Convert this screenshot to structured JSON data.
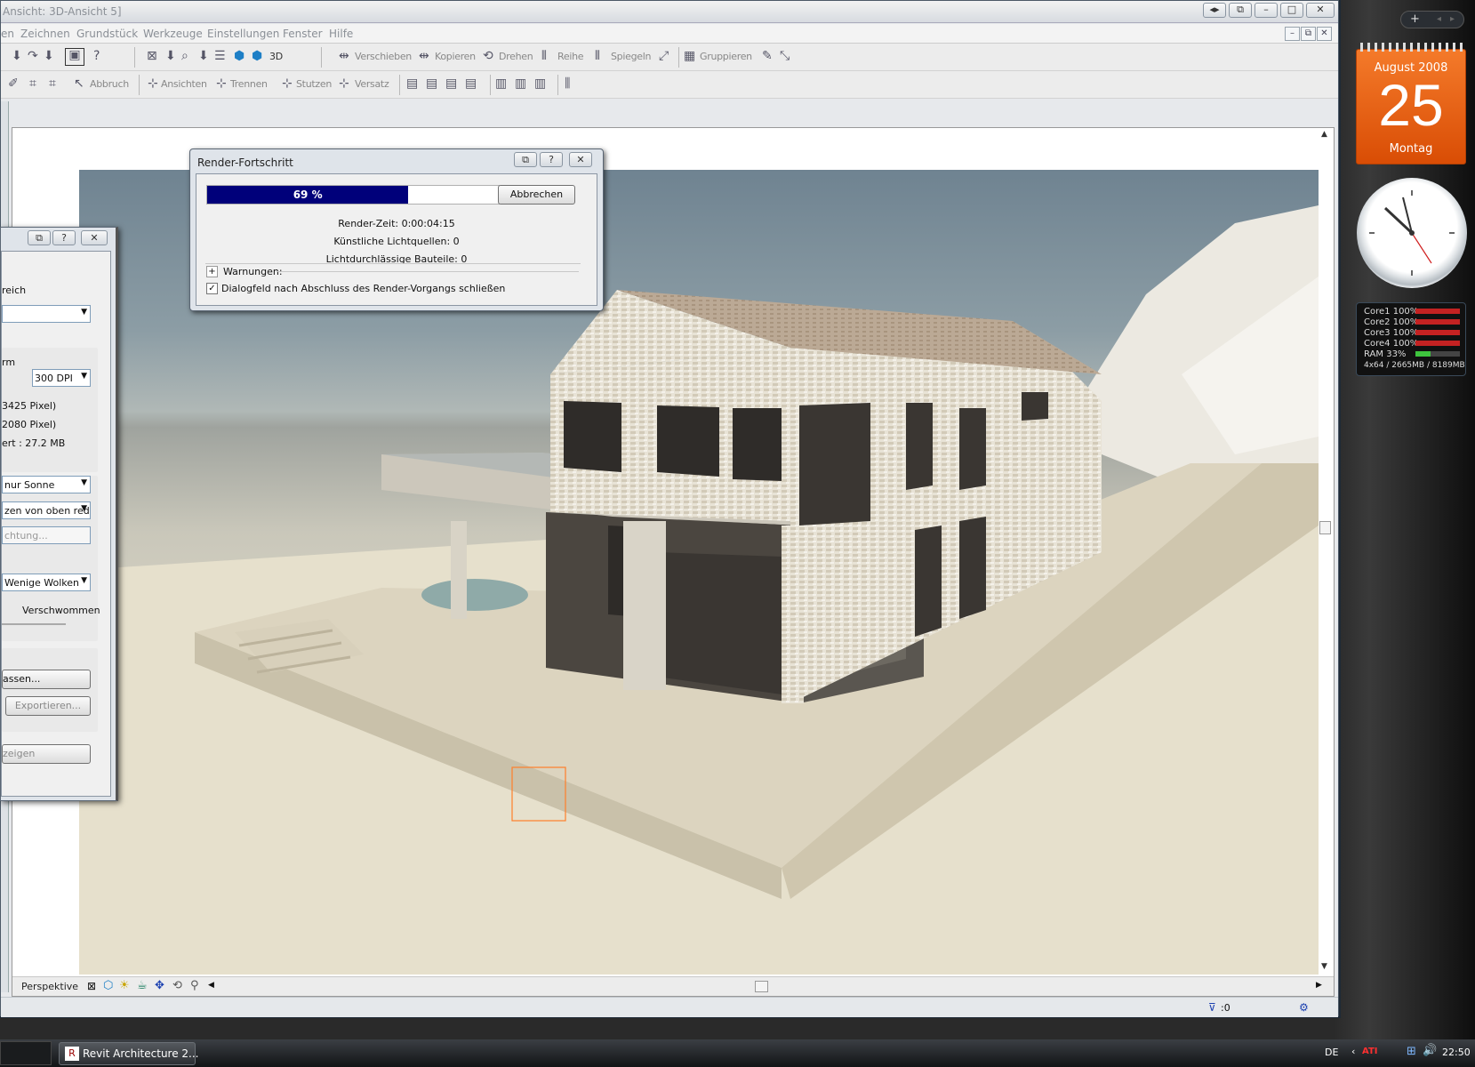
{
  "window": {
    "title": "Ansicht: 3D-Ansicht 5]",
    "buttons": [
      "◂▸",
      "⧉",
      "–",
      "□",
      "✕"
    ]
  },
  "menu": [
    "en",
    "Zeichnen",
    "Grundstück",
    "Werkzeuge",
    "Einstellungen",
    "Fenster",
    "Hilfe"
  ],
  "toolbar1": {
    "label_3d": "3D",
    "items": [
      "Verschieben",
      "Kopieren",
      "Drehen",
      "Reihe",
      "Spiegeln",
      "Gruppieren"
    ]
  },
  "toolbar2": {
    "items": [
      "Abbruch",
      "Ansichten",
      "Trennen",
      "Stutzen",
      "Versatz"
    ]
  },
  "render_dialog": {
    "title": "Render-Fortschritt",
    "progress": 0.69,
    "progress_text": "69 %",
    "cancel_label": "Abbrechen",
    "render_time": "Render-Zeit: 0:00:04:15",
    "artificial_lights": "Künstliche Lichtquellen: 0",
    "translucent_parts": "Lichtdurchlässige Bauteile: 0",
    "warnings_label": "Warnungen:",
    "close_checkbox_label": "Dialogfeld nach Abschluss des Render-Vorgangs schließen",
    "close_checkbox_checked": true
  },
  "left_dialog": {
    "reich": "reich",
    "rm": "rm",
    "dpi": "300 DPI",
    "px1": "3425 Pixel)",
    "px2": "2080 Pixel)",
    "size": "ert :  27.2 MB",
    "sun": "nur Sonne",
    "sky": "zen von oben red",
    "light_btn": "chtung...",
    "clouds": "Wenige Wolken",
    "blur": "Verschwommen",
    "adjust_btn": "assen...",
    "export_btn": "Exportieren...",
    "show_btn": "zeigen"
  },
  "view": {
    "label": "Perspektive",
    "filter": ":0"
  },
  "gadgets": {
    "month": "August 2008",
    "day": "25",
    "weekday": "Montag",
    "cores": [
      {
        "name": "Core1",
        "val": "100%"
      },
      {
        "name": "Core2",
        "val": "100%"
      },
      {
        "name": "Core3",
        "val": "100%"
      },
      {
        "name": "Core4",
        "val": "100%"
      }
    ],
    "ram": {
      "name": "RAM",
      "val": "33%"
    },
    "mem": "4x64 / 2665MB / 8189MB"
  },
  "taskbar": {
    "task": "Revit Architecture 2...",
    "lang": "DE",
    "time": "22:50",
    "tray": "ATI"
  }
}
